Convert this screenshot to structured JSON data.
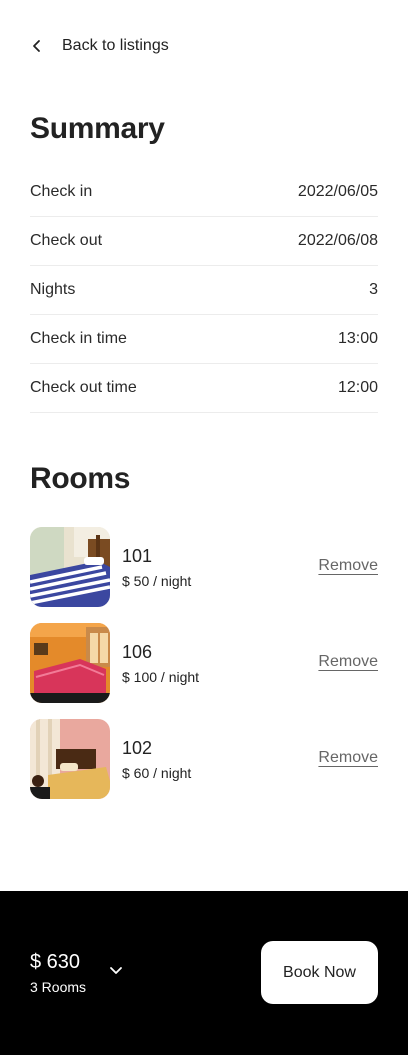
{
  "header": {
    "back_label": "Back to listings"
  },
  "summary": {
    "title": "Summary",
    "rows": [
      {
        "label": "Check in",
        "value": "2022/06/05"
      },
      {
        "label": "Check out",
        "value": "2022/06/08"
      },
      {
        "label": "Nights",
        "value": "3"
      },
      {
        "label": "Check in time",
        "value": "13:00"
      },
      {
        "label": "Check out time",
        "value": "12:00"
      }
    ]
  },
  "rooms": {
    "title": "Rooms",
    "items": [
      {
        "name": "101",
        "price": "$ 50 / night",
        "remove_label": "Remove"
      },
      {
        "name": "106",
        "price": "$ 100 / night",
        "remove_label": "Remove"
      },
      {
        "name": "102",
        "price": "$ 60 / night",
        "remove_label": "Remove"
      }
    ]
  },
  "footer": {
    "total": "$ 630",
    "room_count": "3 Rooms",
    "book_label": "Book Now"
  },
  "colors": {
    "footer_bg": "#000000",
    "button_bg": "#ffffff",
    "text": "#222222"
  },
  "icons": {
    "back": "chevron-left-icon",
    "expand": "chevron-down-icon"
  }
}
